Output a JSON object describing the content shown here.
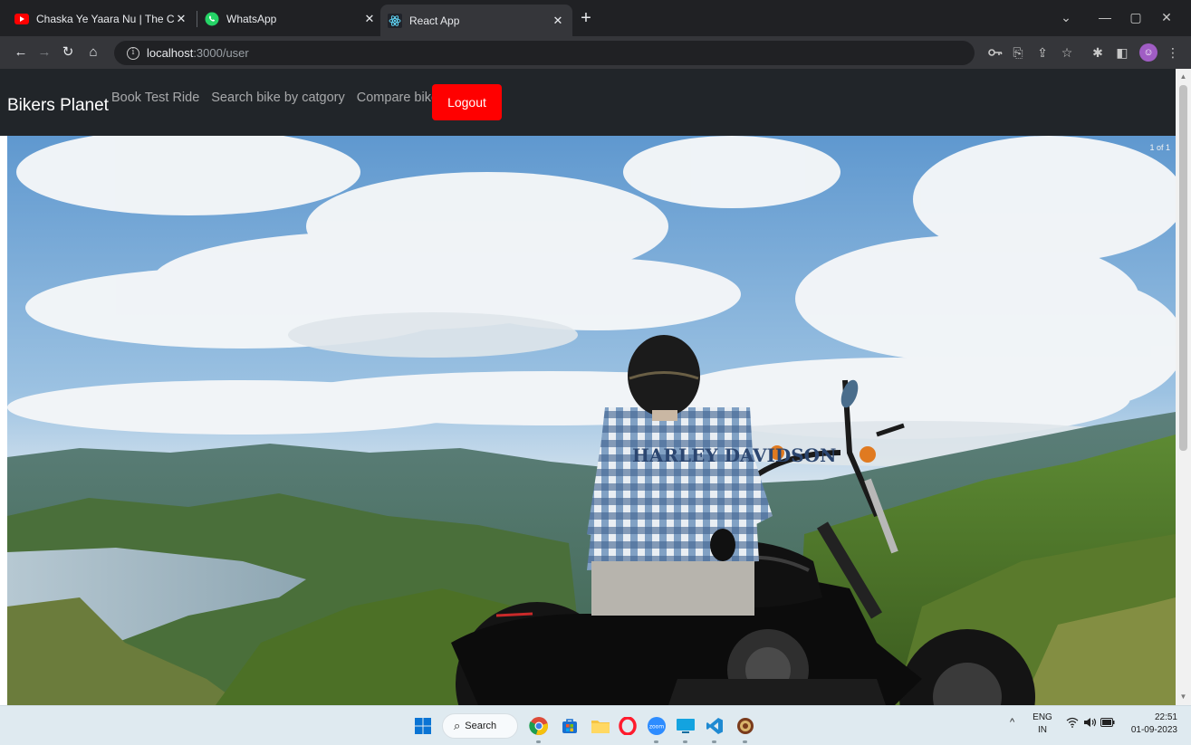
{
  "browser": {
    "tabs": [
      {
        "title": "Chaska Ye Yaara Nu | The Crown",
        "favicon": "youtube-icon",
        "active": false
      },
      {
        "title": "WhatsApp",
        "favicon": "whatsapp-icon",
        "active": false
      },
      {
        "title": "React App",
        "favicon": "react-icon",
        "active": true
      }
    ],
    "url_host": "localhost",
    "url_path": ":3000/user"
  },
  "app": {
    "brand": "Bikers Planet",
    "nav": {
      "book_test_ride": "Book Test Ride",
      "search_by_category": "Search bike by catgory",
      "compare_bikes": "Compare bikes"
    },
    "logout_label": "Logout",
    "carousel_counter": "1 of 1",
    "hero_helmet_text": "HARLEY DAVIDSON"
  },
  "taskbar": {
    "search_label": "Search",
    "lang_line1": "ENG",
    "lang_line2": "IN",
    "time": "22:51",
    "date": "01-09-2023"
  },
  "colors": {
    "navbar_bg": "#212529",
    "logout_bg": "#ff0000",
    "chrome_dark": "#202124",
    "chrome_toolbar": "#35363a"
  }
}
